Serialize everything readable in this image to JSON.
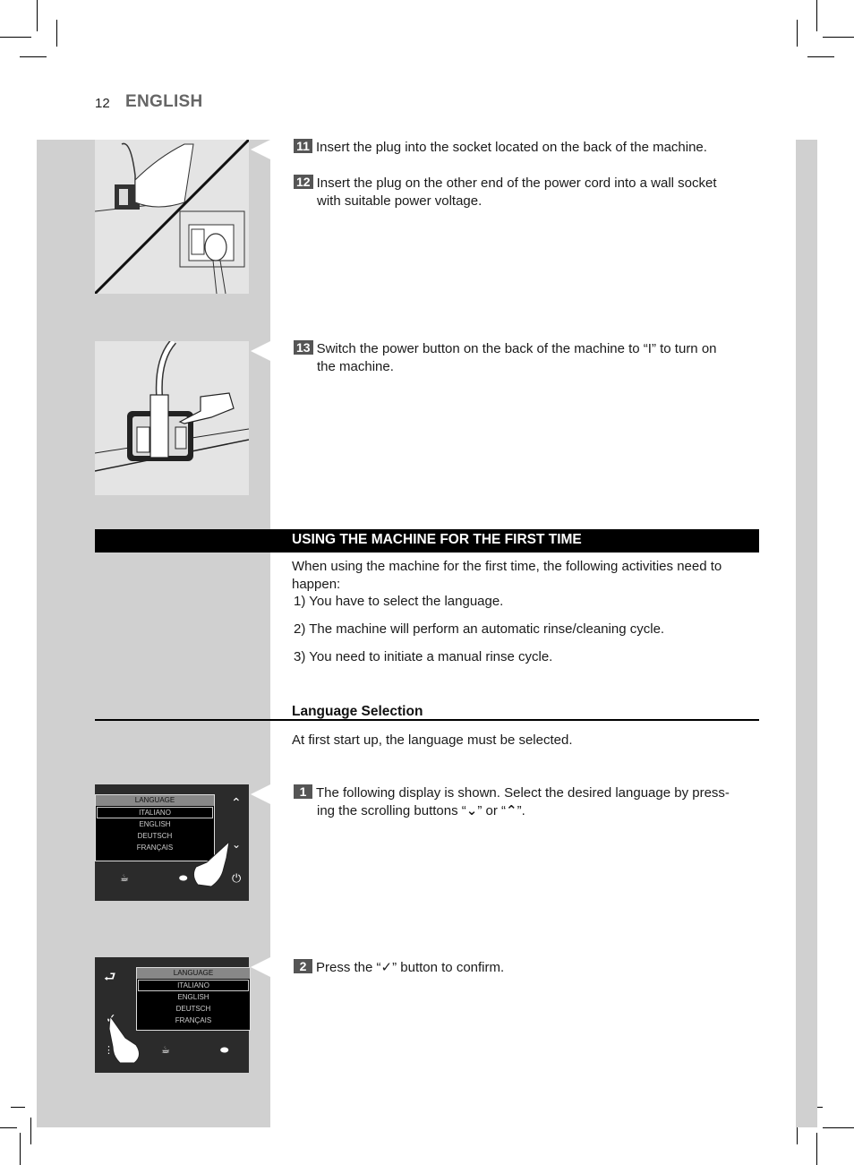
{
  "header": {
    "page_number": "12",
    "language": "ENGLISH"
  },
  "steps_top": [
    {
      "number": "11",
      "text": "Insert the plug into the socket located on the back of the machine."
    },
    {
      "number": "12",
      "line1": "Insert the plug on the other end of the power cord into a wall socket",
      "line2": "with suitable power voltage."
    },
    {
      "number": "13",
      "line1": "Switch the power button on the back of the machine to “I” to turn on",
      "line2": "the machine."
    }
  ],
  "section": {
    "title": "USING THE MACHINE FOR THE FIRST TIME",
    "intro_line1": "When using the machine for the first time, the following activities need to",
    "intro_line2": "happen:",
    "items": [
      "1) You have to select the language.",
      "2) The machine will perform an automatic rinse/cleaning cycle.",
      "3) You need to initiate a manual rinse cycle."
    ]
  },
  "language_selection": {
    "heading": "Language Selection",
    "intro": "At first start up, the language must be selected.",
    "step1": {
      "number": "1",
      "line1": "The following display is shown. Select the desired language by press-",
      "line2_a": "ing the scrolling buttons “",
      "line2_b": "” or “",
      "line2_c": "”."
    },
    "step2": {
      "number": "2",
      "text_a": "Press the “",
      "text_b": "” button to confirm."
    }
  },
  "display": {
    "header": "LANGUAGE",
    "options": [
      "ITALIANO",
      "ENGLISH",
      "DEUTSCH",
      "FRANÇAIS"
    ],
    "selected": "ITALIANO",
    "icons": [
      "up-arrow",
      "down-arrow",
      "special-coffee",
      "coffee-bean",
      "power",
      "back",
      "check",
      "menu"
    ]
  }
}
